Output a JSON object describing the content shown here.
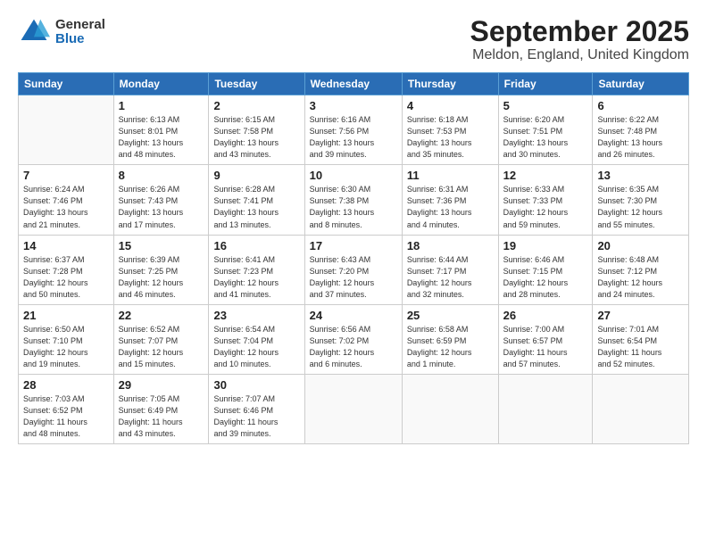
{
  "header": {
    "logo_general": "General",
    "logo_blue": "Blue",
    "month_title": "September 2025",
    "location": "Meldon, England, United Kingdom"
  },
  "weekdays": [
    "Sunday",
    "Monday",
    "Tuesday",
    "Wednesday",
    "Thursday",
    "Friday",
    "Saturday"
  ],
  "weeks": [
    [
      {
        "day": "",
        "info": ""
      },
      {
        "day": "1",
        "info": "Sunrise: 6:13 AM\nSunset: 8:01 PM\nDaylight: 13 hours\nand 48 minutes."
      },
      {
        "day": "2",
        "info": "Sunrise: 6:15 AM\nSunset: 7:58 PM\nDaylight: 13 hours\nand 43 minutes."
      },
      {
        "day": "3",
        "info": "Sunrise: 6:16 AM\nSunset: 7:56 PM\nDaylight: 13 hours\nand 39 minutes."
      },
      {
        "day": "4",
        "info": "Sunrise: 6:18 AM\nSunset: 7:53 PM\nDaylight: 13 hours\nand 35 minutes."
      },
      {
        "day": "5",
        "info": "Sunrise: 6:20 AM\nSunset: 7:51 PM\nDaylight: 13 hours\nand 30 minutes."
      },
      {
        "day": "6",
        "info": "Sunrise: 6:22 AM\nSunset: 7:48 PM\nDaylight: 13 hours\nand 26 minutes."
      }
    ],
    [
      {
        "day": "7",
        "info": "Sunrise: 6:24 AM\nSunset: 7:46 PM\nDaylight: 13 hours\nand 21 minutes."
      },
      {
        "day": "8",
        "info": "Sunrise: 6:26 AM\nSunset: 7:43 PM\nDaylight: 13 hours\nand 17 minutes."
      },
      {
        "day": "9",
        "info": "Sunrise: 6:28 AM\nSunset: 7:41 PM\nDaylight: 13 hours\nand 13 minutes."
      },
      {
        "day": "10",
        "info": "Sunrise: 6:30 AM\nSunset: 7:38 PM\nDaylight: 13 hours\nand 8 minutes."
      },
      {
        "day": "11",
        "info": "Sunrise: 6:31 AM\nSunset: 7:36 PM\nDaylight: 13 hours\nand 4 minutes."
      },
      {
        "day": "12",
        "info": "Sunrise: 6:33 AM\nSunset: 7:33 PM\nDaylight: 12 hours\nand 59 minutes."
      },
      {
        "day": "13",
        "info": "Sunrise: 6:35 AM\nSunset: 7:30 PM\nDaylight: 12 hours\nand 55 minutes."
      }
    ],
    [
      {
        "day": "14",
        "info": "Sunrise: 6:37 AM\nSunset: 7:28 PM\nDaylight: 12 hours\nand 50 minutes."
      },
      {
        "day": "15",
        "info": "Sunrise: 6:39 AM\nSunset: 7:25 PM\nDaylight: 12 hours\nand 46 minutes."
      },
      {
        "day": "16",
        "info": "Sunrise: 6:41 AM\nSunset: 7:23 PM\nDaylight: 12 hours\nand 41 minutes."
      },
      {
        "day": "17",
        "info": "Sunrise: 6:43 AM\nSunset: 7:20 PM\nDaylight: 12 hours\nand 37 minutes."
      },
      {
        "day": "18",
        "info": "Sunrise: 6:44 AM\nSunset: 7:17 PM\nDaylight: 12 hours\nand 32 minutes."
      },
      {
        "day": "19",
        "info": "Sunrise: 6:46 AM\nSunset: 7:15 PM\nDaylight: 12 hours\nand 28 minutes."
      },
      {
        "day": "20",
        "info": "Sunrise: 6:48 AM\nSunset: 7:12 PM\nDaylight: 12 hours\nand 24 minutes."
      }
    ],
    [
      {
        "day": "21",
        "info": "Sunrise: 6:50 AM\nSunset: 7:10 PM\nDaylight: 12 hours\nand 19 minutes."
      },
      {
        "day": "22",
        "info": "Sunrise: 6:52 AM\nSunset: 7:07 PM\nDaylight: 12 hours\nand 15 minutes."
      },
      {
        "day": "23",
        "info": "Sunrise: 6:54 AM\nSunset: 7:04 PM\nDaylight: 12 hours\nand 10 minutes."
      },
      {
        "day": "24",
        "info": "Sunrise: 6:56 AM\nSunset: 7:02 PM\nDaylight: 12 hours\nand 6 minutes."
      },
      {
        "day": "25",
        "info": "Sunrise: 6:58 AM\nSunset: 6:59 PM\nDaylight: 12 hours\nand 1 minute."
      },
      {
        "day": "26",
        "info": "Sunrise: 7:00 AM\nSunset: 6:57 PM\nDaylight: 11 hours\nand 57 minutes."
      },
      {
        "day": "27",
        "info": "Sunrise: 7:01 AM\nSunset: 6:54 PM\nDaylight: 11 hours\nand 52 minutes."
      }
    ],
    [
      {
        "day": "28",
        "info": "Sunrise: 7:03 AM\nSunset: 6:52 PM\nDaylight: 11 hours\nand 48 minutes."
      },
      {
        "day": "29",
        "info": "Sunrise: 7:05 AM\nSunset: 6:49 PM\nDaylight: 11 hours\nand 43 minutes."
      },
      {
        "day": "30",
        "info": "Sunrise: 7:07 AM\nSunset: 6:46 PM\nDaylight: 11 hours\nand 39 minutes."
      },
      {
        "day": "",
        "info": ""
      },
      {
        "day": "",
        "info": ""
      },
      {
        "day": "",
        "info": ""
      },
      {
        "day": "",
        "info": ""
      }
    ]
  ]
}
